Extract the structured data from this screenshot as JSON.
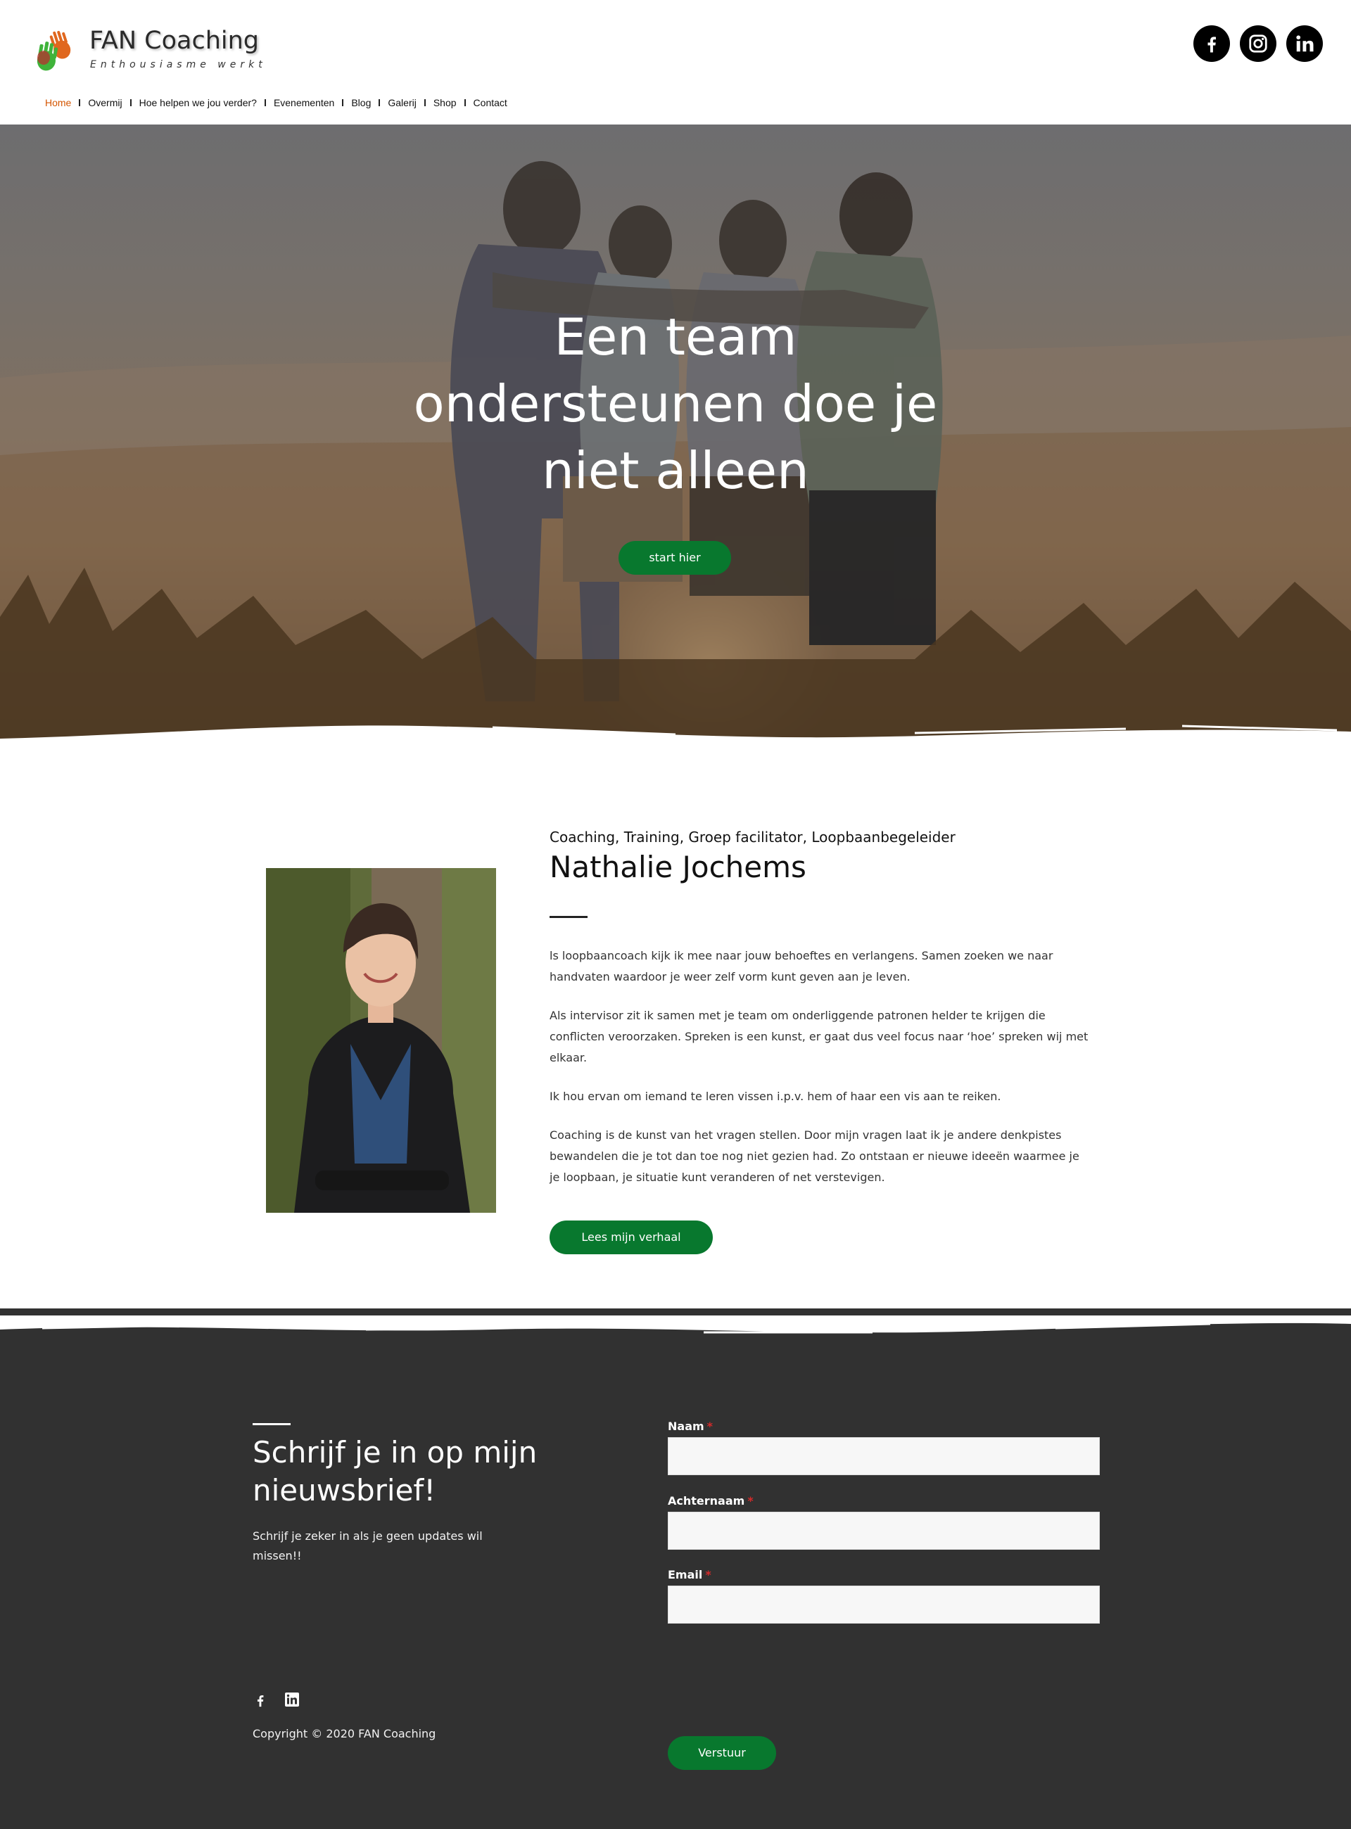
{
  "brand": {
    "name": "FAN Coaching",
    "tagline": "Enthousiasme werkt"
  },
  "nav": {
    "items": [
      {
        "label": "Home",
        "active": true
      },
      {
        "label": "Overmij"
      },
      {
        "label": "Hoe helpen we jou verder?"
      },
      {
        "label": "Evenementen"
      },
      {
        "label": "Blog"
      },
      {
        "label": "Galerij"
      },
      {
        "label": "Shop"
      },
      {
        "label": "Contact"
      }
    ]
  },
  "social_top": [
    "facebook-icon",
    "instagram-icon",
    "linkedin-icon"
  ],
  "hero": {
    "title_line1": "Een team",
    "title_line2": "ondersteunen doe je",
    "title_line3": "niet alleen",
    "cta": "start hier"
  },
  "about": {
    "subtitle": "Coaching, Training, Groep facilitator, Loopbaanbegeleider",
    "name": "Nathalie Jochems",
    "paragraphs": [
      "ls loopbaancoach kijk ik mee naar jouw behoeftes en verlangens. Samen zoeken we naar handvaten waardoor je weer zelf vorm kunt geven aan je leven.",
      "Als intervisor zit ik samen met je team om onderliggende patronen helder te krijgen die conflicten veroorzaken. Spreken is een kunst, er gaat dus veel focus naar ‘hoe’ spreken wij met elkaar.",
      "Ik hou ervan om iemand te leren vissen i.p.v. hem of haar een vis aan te reiken.",
      "Coaching is de kunst van het vragen stellen. Door mijn vragen laat ik je andere denkpistes bewandelen die je tot dan toe nog niet gezien had. Zo ontstaan er nieuwe ideeën waarmee je je loopbaan, je situatie kunt veranderen of net verstevigen."
    ],
    "cta": "Lees mijn verhaal"
  },
  "newsletter": {
    "title": "Schrijf je in op mijn nieuwsbrief!",
    "subtitle": "Schrijf je zeker in als je geen updates wil missen!!",
    "fields": [
      {
        "label": "Naam",
        "required_mark": "*",
        "value": ""
      },
      {
        "label": "Achternaam",
        "required_mark": "*",
        "value": ""
      },
      {
        "label": "Email",
        "required_mark": "*",
        "value": ""
      }
    ],
    "submit": "Verstuur"
  },
  "footer": {
    "social": [
      "facebook-icon",
      "linkedin-icon"
    ],
    "copyright": "Copyright © 2020 FAN Coaching"
  },
  "colors": {
    "accent_green": "#08782e",
    "nav_active": "#d45500",
    "footer_bg": "#313131"
  }
}
